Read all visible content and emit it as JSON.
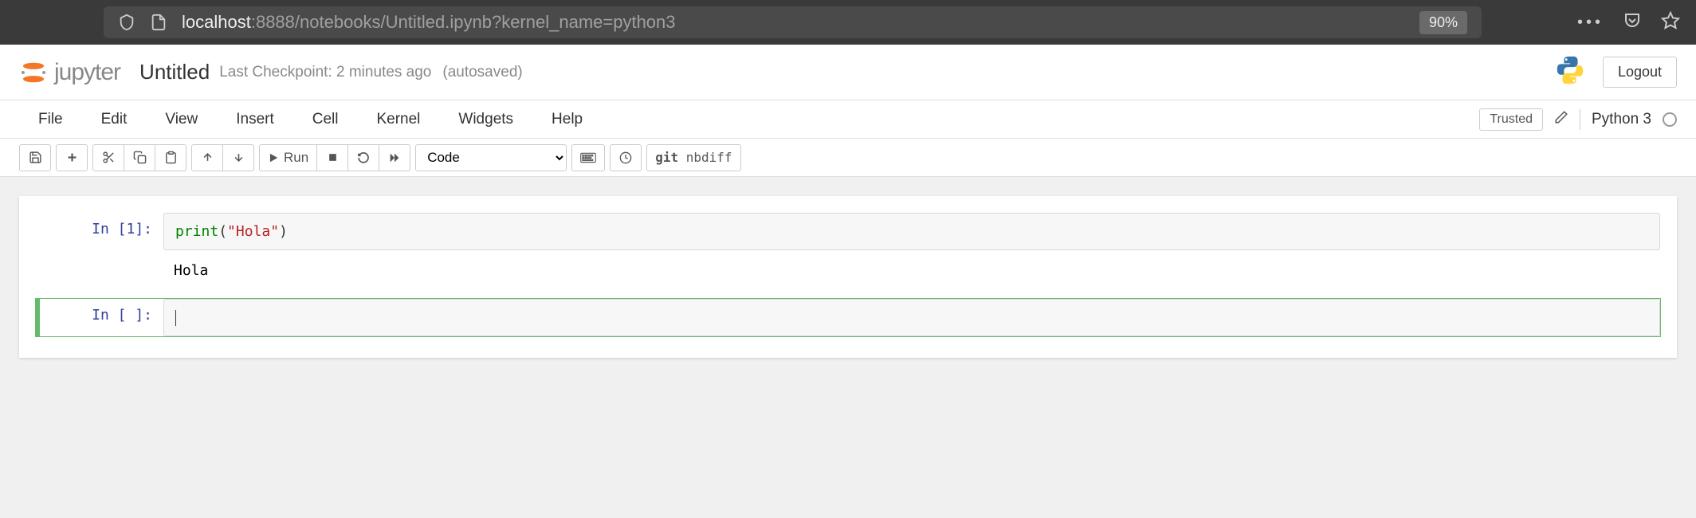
{
  "browser": {
    "url_host": "localhost",
    "url_port": ":8888",
    "url_path": "/notebooks/Untitled.ipynb?kernel_name=python3",
    "zoom": "90%"
  },
  "header": {
    "logo_text": "jupyter",
    "title": "Untitled",
    "checkpoint": "Last Checkpoint: 2 minutes ago",
    "autosaved": "(autosaved)",
    "logout": "Logout"
  },
  "menubar": {
    "items": [
      "File",
      "Edit",
      "View",
      "Insert",
      "Cell",
      "Kernel",
      "Widgets",
      "Help"
    ],
    "trusted": "Trusted",
    "kernel": "Python 3"
  },
  "toolbar": {
    "run_label": "Run",
    "cell_type": "Code",
    "nbdiff_prefix": "git",
    "nbdiff_cmd": "nbdiff"
  },
  "cells": [
    {
      "prompt": "In [1]:",
      "code_fn": "print",
      "code_open": "(",
      "code_str": "\"Hola\"",
      "code_close": ")",
      "output": "Hola"
    },
    {
      "prompt": "In [ ]:",
      "code": ""
    }
  ]
}
